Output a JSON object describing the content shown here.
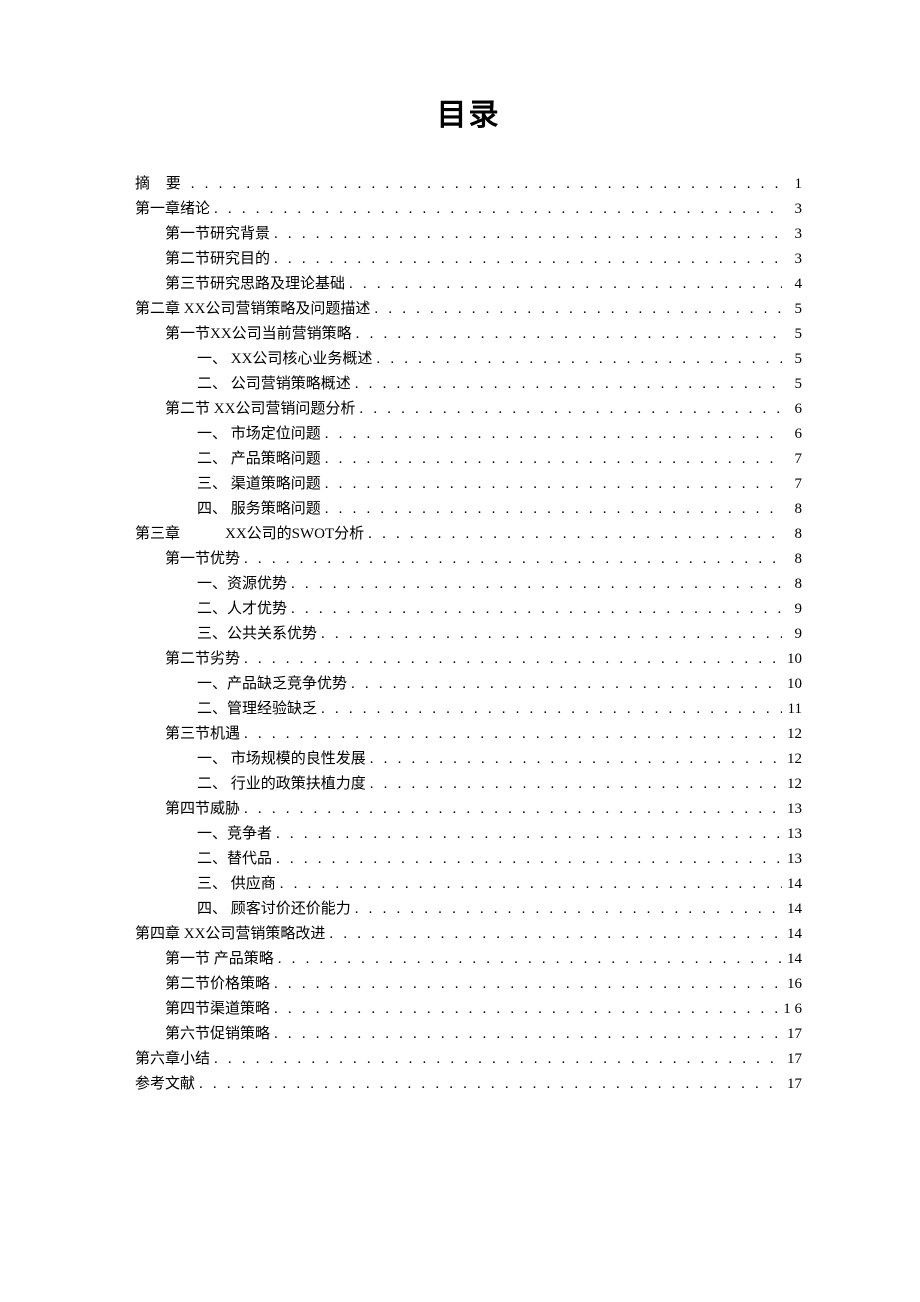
{
  "title": "目录",
  "toc": [
    {
      "indent": 0,
      "label": "摘 要",
      "page": "1",
      "spaced": true
    },
    {
      "indent": 0,
      "label": "第一章绪论",
      "page": "3"
    },
    {
      "indent": 1,
      "label": "第一节研究背景",
      "page": "3"
    },
    {
      "indent": 1,
      "label": "第二节研究目的",
      "page": "3"
    },
    {
      "indent": 1,
      "label": "第三节研究思路及理论基础",
      "page": "4"
    },
    {
      "indent": 0,
      "label": "第二章 XX公司营销策略及问题描述",
      "page": "5"
    },
    {
      "indent": 1,
      "label": "第一节XX公司当前营销策略",
      "page": "5"
    },
    {
      "indent": 2,
      "label": "一、 XX公司核心业务概述",
      "page": "5"
    },
    {
      "indent": 2,
      "label": "二、 公司营销策略概述",
      "page": "5"
    },
    {
      "indent": 1,
      "label": "第二节 XX公司营销问题分析",
      "page": "6"
    },
    {
      "indent": 2,
      "label": "一、 市场定位问题",
      "page": "6"
    },
    {
      "indent": 2,
      "label": "二、 产品策略问题",
      "page": "7"
    },
    {
      "indent": 2,
      "label": "三、 渠道策略问题",
      "page": "7"
    },
    {
      "indent": 2,
      "label": "四、 服务策略问题",
      "page": "8"
    },
    {
      "indent": 0,
      "label": "第三章　　　XX公司的SWOT分析",
      "page": "8"
    },
    {
      "indent": 1,
      "label": "第一节优势",
      "page": "8"
    },
    {
      "indent": 2,
      "label": "一、资源优势",
      "page": "8"
    },
    {
      "indent": 2,
      "label": "二、人才优势",
      "page": "9"
    },
    {
      "indent": 2,
      "label": "三、公共关系优势",
      "page": "9"
    },
    {
      "indent": 1,
      "label": "第二节劣势",
      "page": "10"
    },
    {
      "indent": 2,
      "label": "一、产品缺乏竞争优势",
      "page": "10"
    },
    {
      "indent": 2,
      "label": "二、管理经验缺乏",
      "page": "11"
    },
    {
      "indent": 1,
      "label": "第三节机遇",
      "page": "12"
    },
    {
      "indent": 2,
      "label": "一、 市场规模的良性发展",
      "page": "12"
    },
    {
      "indent": 2,
      "label": "二、 行业的政策扶植力度",
      "page": "12"
    },
    {
      "indent": 1,
      "label": "第四节威胁",
      "page": "13"
    },
    {
      "indent": 2,
      "label": "一、竞争者",
      "page": "13"
    },
    {
      "indent": 2,
      "label": "二、替代品",
      "page": "13"
    },
    {
      "indent": 2,
      "label": "三、 供应商",
      "page": "14"
    },
    {
      "indent": 2,
      "label": "四、 顾客讨价还价能力",
      "page": "14"
    },
    {
      "indent": 0,
      "label": "第四章 XX公司营销策略改进",
      "page": "14"
    },
    {
      "indent": 1,
      "label": "第一节 产品策略",
      "page": "14"
    },
    {
      "indent": 1,
      "label": "第二节价格策略",
      "page": "16"
    },
    {
      "indent": 1,
      "label": "第四节渠道策略",
      "page": "1 6"
    },
    {
      "indent": 1,
      "label": "第六节促销策略",
      "page": "17"
    },
    {
      "indent": 0,
      "label": "第六章小结",
      "page": "17"
    },
    {
      "indent": 0,
      "label": "参考文献",
      "page": "17"
    }
  ]
}
